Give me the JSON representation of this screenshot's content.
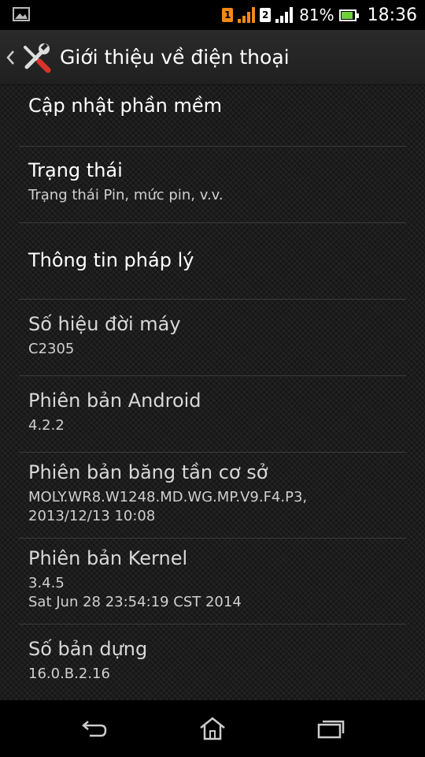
{
  "status_bar": {
    "sim1_label": "1",
    "sim2_label": "2",
    "battery_percent": "81%",
    "battery_level": 0.81,
    "time": "18:36",
    "icons": [
      "image-notification-icon",
      "signal-icon",
      "signal-icon",
      "battery-icon"
    ]
  },
  "action_bar": {
    "title": "Giới thiệu về điện thoại",
    "icon": "tools-icon"
  },
  "items": [
    {
      "title": "Cập nhật phần mềm"
    },
    {
      "title": "Trạng thái",
      "sub": "Trạng thái Pin, mức pin, v.v."
    },
    {
      "title": "Thông tin pháp lý"
    },
    {
      "title": "Số hiệu đời máy",
      "sub": "C2305"
    },
    {
      "title": "Phiên bản Android",
      "sub": "4.2.2"
    },
    {
      "title": "Phiên bản băng tần cơ sở",
      "sub": "MOLY.WR8.W1248.MD.WG.MP.V9.F4.P3,",
      "sub2": "2013/12/13 10:08"
    },
    {
      "title": "Phiên bản Kernel",
      "sub": "3.4.5",
      "sub2": "Sat Jun 28 23:54:19 CST 2014"
    },
    {
      "title": "Số bản dựng",
      "sub": "16.0.B.2.16"
    }
  ],
  "nav_bar": {
    "icons": [
      "back-icon",
      "home-icon",
      "recent-apps-icon"
    ]
  },
  "colors": {
    "sim1": "#f08a17",
    "signal_orange": "#f08a17",
    "battery_fill": "#6fd13a",
    "tools_red": "#d9332b"
  }
}
